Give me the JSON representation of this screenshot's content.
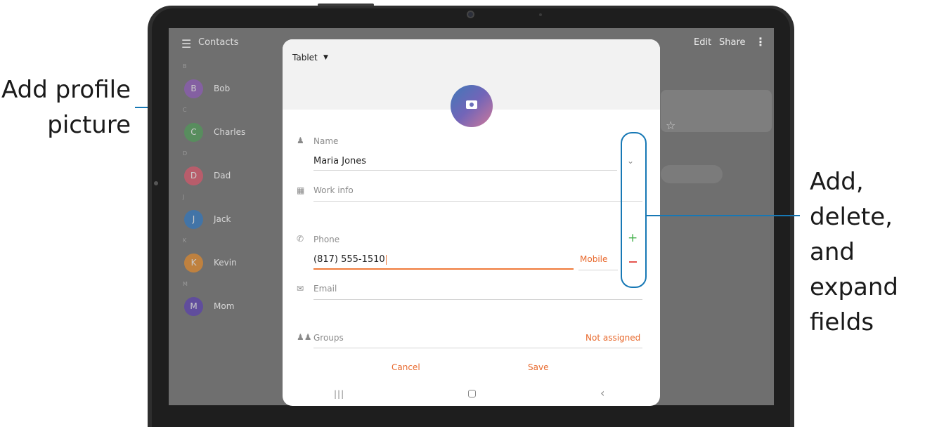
{
  "callouts": {
    "left_line1": "Add profile",
    "left_line2": "picture",
    "right_line1": "Add, delete,",
    "right_line2": "and expand",
    "right_line3": "fields"
  },
  "app_bar": {
    "menu_icon": "hamburger-icon",
    "title": "Contacts",
    "edit": "Edit",
    "share": "Share",
    "more_icon": "more-vertical-icon"
  },
  "contacts": [
    {
      "index": "B",
      "initial": "B",
      "name": "Bob",
      "color": "#8e5bb8"
    },
    {
      "index": "C",
      "initial": "C",
      "name": "Charles",
      "color": "#4f9a57"
    },
    {
      "index": "D",
      "initial": "D",
      "name": "Dad",
      "color": "#d8566a"
    },
    {
      "index": "J",
      "initial": "J",
      "name": "Jack",
      "color": "#2f77c0"
    },
    {
      "index": "K",
      "initial": "K",
      "name": "Kevin",
      "color": "#e28a2c"
    },
    {
      "index": "M",
      "initial": "M",
      "name": "Mom",
      "color": "#5a3fb0"
    }
  ],
  "dialog": {
    "account": "Tablet",
    "photo_icon": "camera-icon",
    "name_label": "Name",
    "name_value": "Maria Jones",
    "work_label": "Work info",
    "phone_label": "Phone",
    "phone_value": "(817) 555-1510",
    "phone_type": "Mobile",
    "email_label": "Email",
    "groups_label": "Groups",
    "groups_value": "Not assigned",
    "cancel": "Cancel",
    "save": "Save"
  },
  "colors": {
    "accent": "#e8692d",
    "callout_line": "#1778b5",
    "add": "#43b04a",
    "remove": "#e5554f"
  }
}
